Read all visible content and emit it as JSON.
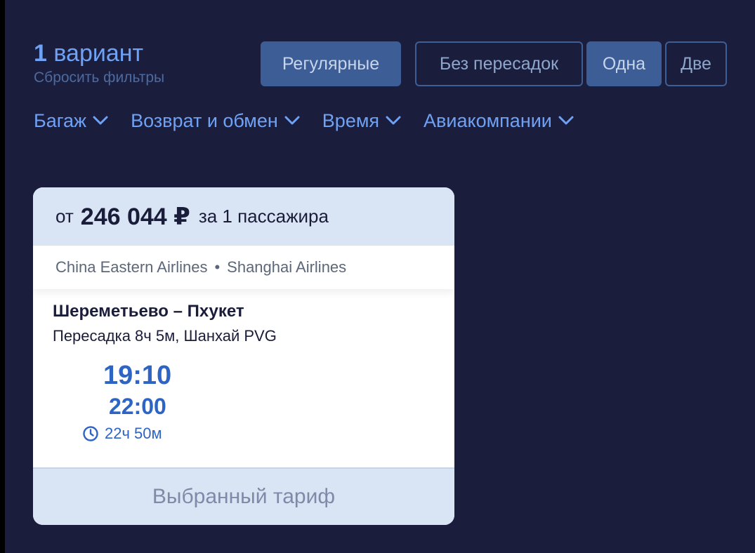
{
  "header": {
    "count_number": "1",
    "count_label": "вариант",
    "reset_label": "Сбросить фильтры"
  },
  "chips": {
    "regular": "Регулярные",
    "nonstop": "Без пересадок",
    "one": "Одна",
    "two": "Две"
  },
  "filters": {
    "baggage": "Багаж",
    "refund": "Возврат и обмен",
    "time": "Время",
    "airlines": "Авиакомпании"
  },
  "card": {
    "price_prefix": "от",
    "price": "246 044 ₽",
    "price_suffix": "за 1 пассажира",
    "airline_1": "China Eastern Airlines",
    "airline_sep": "•",
    "airline_2": "Shanghai Airlines",
    "route_title": "Шереметьево – Пхукет",
    "transfer": "Пересадка 8ч 5м, Шанхай PVG",
    "depart_time": "19:10",
    "arrive_time": "22:00",
    "duration": "22ч 50м",
    "footer_label": "Выбранный тариф"
  },
  "colors": {
    "background": "#1b1d3d",
    "accent": "#6fa2f4",
    "active_chip": "#3c5d96",
    "time_blue": "#2e64c4"
  }
}
